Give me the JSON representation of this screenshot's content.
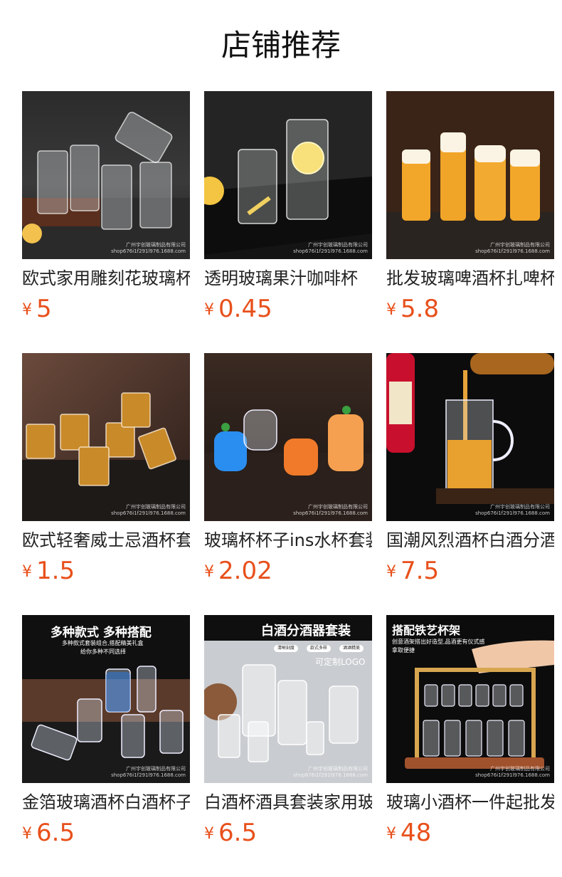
{
  "section": {
    "title": "店铺推荐"
  },
  "products": [
    {
      "name": "欧式家用雕刻花玻璃杯",
      "currency": "¥",
      "price": "5",
      "watermark_line1": "广州宇创玻璃制品有限公司",
      "watermark_line2": "shop676i1f291l976.1688.com"
    },
    {
      "name": "透明玻璃果汁咖啡杯",
      "currency": "¥",
      "price": "0.45",
      "watermark_line1": "广州宇创玻璃制品有限公司",
      "watermark_line2": "shop676i1f291l976.1688.com"
    },
    {
      "name": "批发玻璃啤酒杯扎啤杯",
      "currency": "¥",
      "price": "5.8",
      "watermark_line1": "广州宇创玻璃制品有限公司",
      "watermark_line2": "shop676i1f291l976.1688.com"
    },
    {
      "name": "欧式轻奢威士忌酒杯套装",
      "currency": "¥",
      "price": "1.5",
      "watermark_line1": "广州宇创玻璃制品有限公司",
      "watermark_line2": "shop676i1f291l976.1688.com"
    },
    {
      "name": "玻璃杯杯子ins水杯套装",
      "currency": "¥",
      "price": "2.02",
      "watermark_line1": "广州宇创玻璃制品有限公司",
      "watermark_line2": "shop676i1f291l976.1688.com"
    },
    {
      "name": "国潮风烈酒杯白酒分酒器",
      "currency": "¥",
      "price": "7.5",
      "watermark_line1": "广州宇创玻璃制品有限公司",
      "watermark_line2": "shop676i1f291l976.1688.com"
    },
    {
      "name": "金箔玻璃酒杯白酒杯子",
      "currency": "¥",
      "price": "6.5",
      "watermark_line1": "广州宇创玻璃制品有限公司",
      "watermark_line2": "shop676i1f291l976.1688.com",
      "banner_title": "多种款式 多种搭配",
      "banner_sub1": "多种款式套装组合,搭配精美礼盒",
      "banner_sub2": "给你多种不同选择"
    },
    {
      "name": "白酒杯酒具套装家用玻璃",
      "currency": "¥",
      "price": "6.5",
      "watermark_line1": "广州宇创玻璃制品有限公司",
      "watermark_line2": "shop676i1f291l976.1688.com",
      "banner_title": "白酒分酒器套装",
      "pill1": "清晰刻度",
      "pill2": "款式多样",
      "pill3": "酒酒精美",
      "banner_sub1": "可定制LOGO"
    },
    {
      "name": "玻璃小酒杯一件起批发",
      "currency": "¥",
      "price": "48",
      "watermark_line1": "广州宇创玻璃制品有限公司",
      "watermark_line2": "shop676i1f291l976.1688.com",
      "banner_title": "搭配铁艺杯架",
      "banner_sub1": "创意酒架搭出好造型,品酒更有仪式感",
      "banner_sub2": "拿取便捷"
    }
  ],
  "colors": {
    "price": "#e8501b",
    "title": "#111111"
  }
}
